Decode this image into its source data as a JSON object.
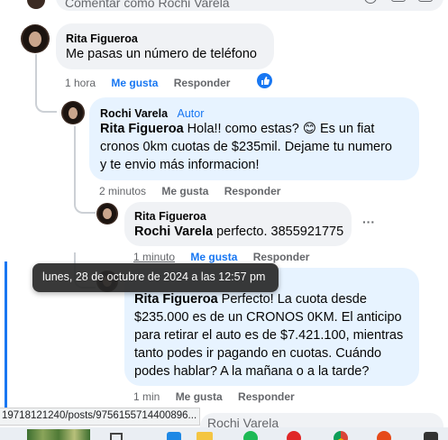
{
  "top_input": {
    "placeholder": "Comentar como Rochi Varela"
  },
  "comments": [
    {
      "author": "Rita Figueroa",
      "text": "Me pasas un número de teléfono",
      "time": "1 hora",
      "like": "Me gusta",
      "reply": "Responder"
    },
    {
      "author": "Rochi Varela",
      "badge": "Autor",
      "mention": "Rita Figueroa",
      "text_a": " Hola!! como estas? ",
      "emoji": "😊",
      "text_b": " Es un fiat",
      "line2": "cronos 0km cuotas de $235mil. Dejame tu numero",
      "line3": "y te envio más informacion!",
      "time": "2 minutos",
      "like": "Me gusta",
      "reply": "Responder"
    },
    {
      "author": "Rita Figueroa",
      "mention": "Rochi Varela",
      "text": " perfecto. 3855921775",
      "time": "1 minuto",
      "like": "Me gusta",
      "reply": "Responder",
      "more": "···"
    },
    {
      "author": "Rochi Varela",
      "mention": "Rita Figueroa",
      "line1": " Perfecto! La cuota desde",
      "line2": "$235.000 es de un CRONOS 0KM. El anticipo",
      "line3": "para retirar el auto es de $7.421.100, mientras",
      "line4": "tanto podes ir pagando en cuotas. Cuándo",
      "line5": "podes hablar? A la mañana o a la tarde?",
      "time": "1 min",
      "like": "Me gusta",
      "reply": "Responder"
    }
  ],
  "tooltip": "lunes, 28 de octubre de 2024 a las 12:57 pm",
  "status_url": "19718121240/posts/9756155714400896...",
  "bottom_input": {
    "partial": "Rochi Varela"
  },
  "colors": {
    "link_blue": "#1877f2",
    "meta_gray": "#65676b",
    "bubble": "#f0f2f5",
    "author_bubble": "#e7f3ff"
  }
}
